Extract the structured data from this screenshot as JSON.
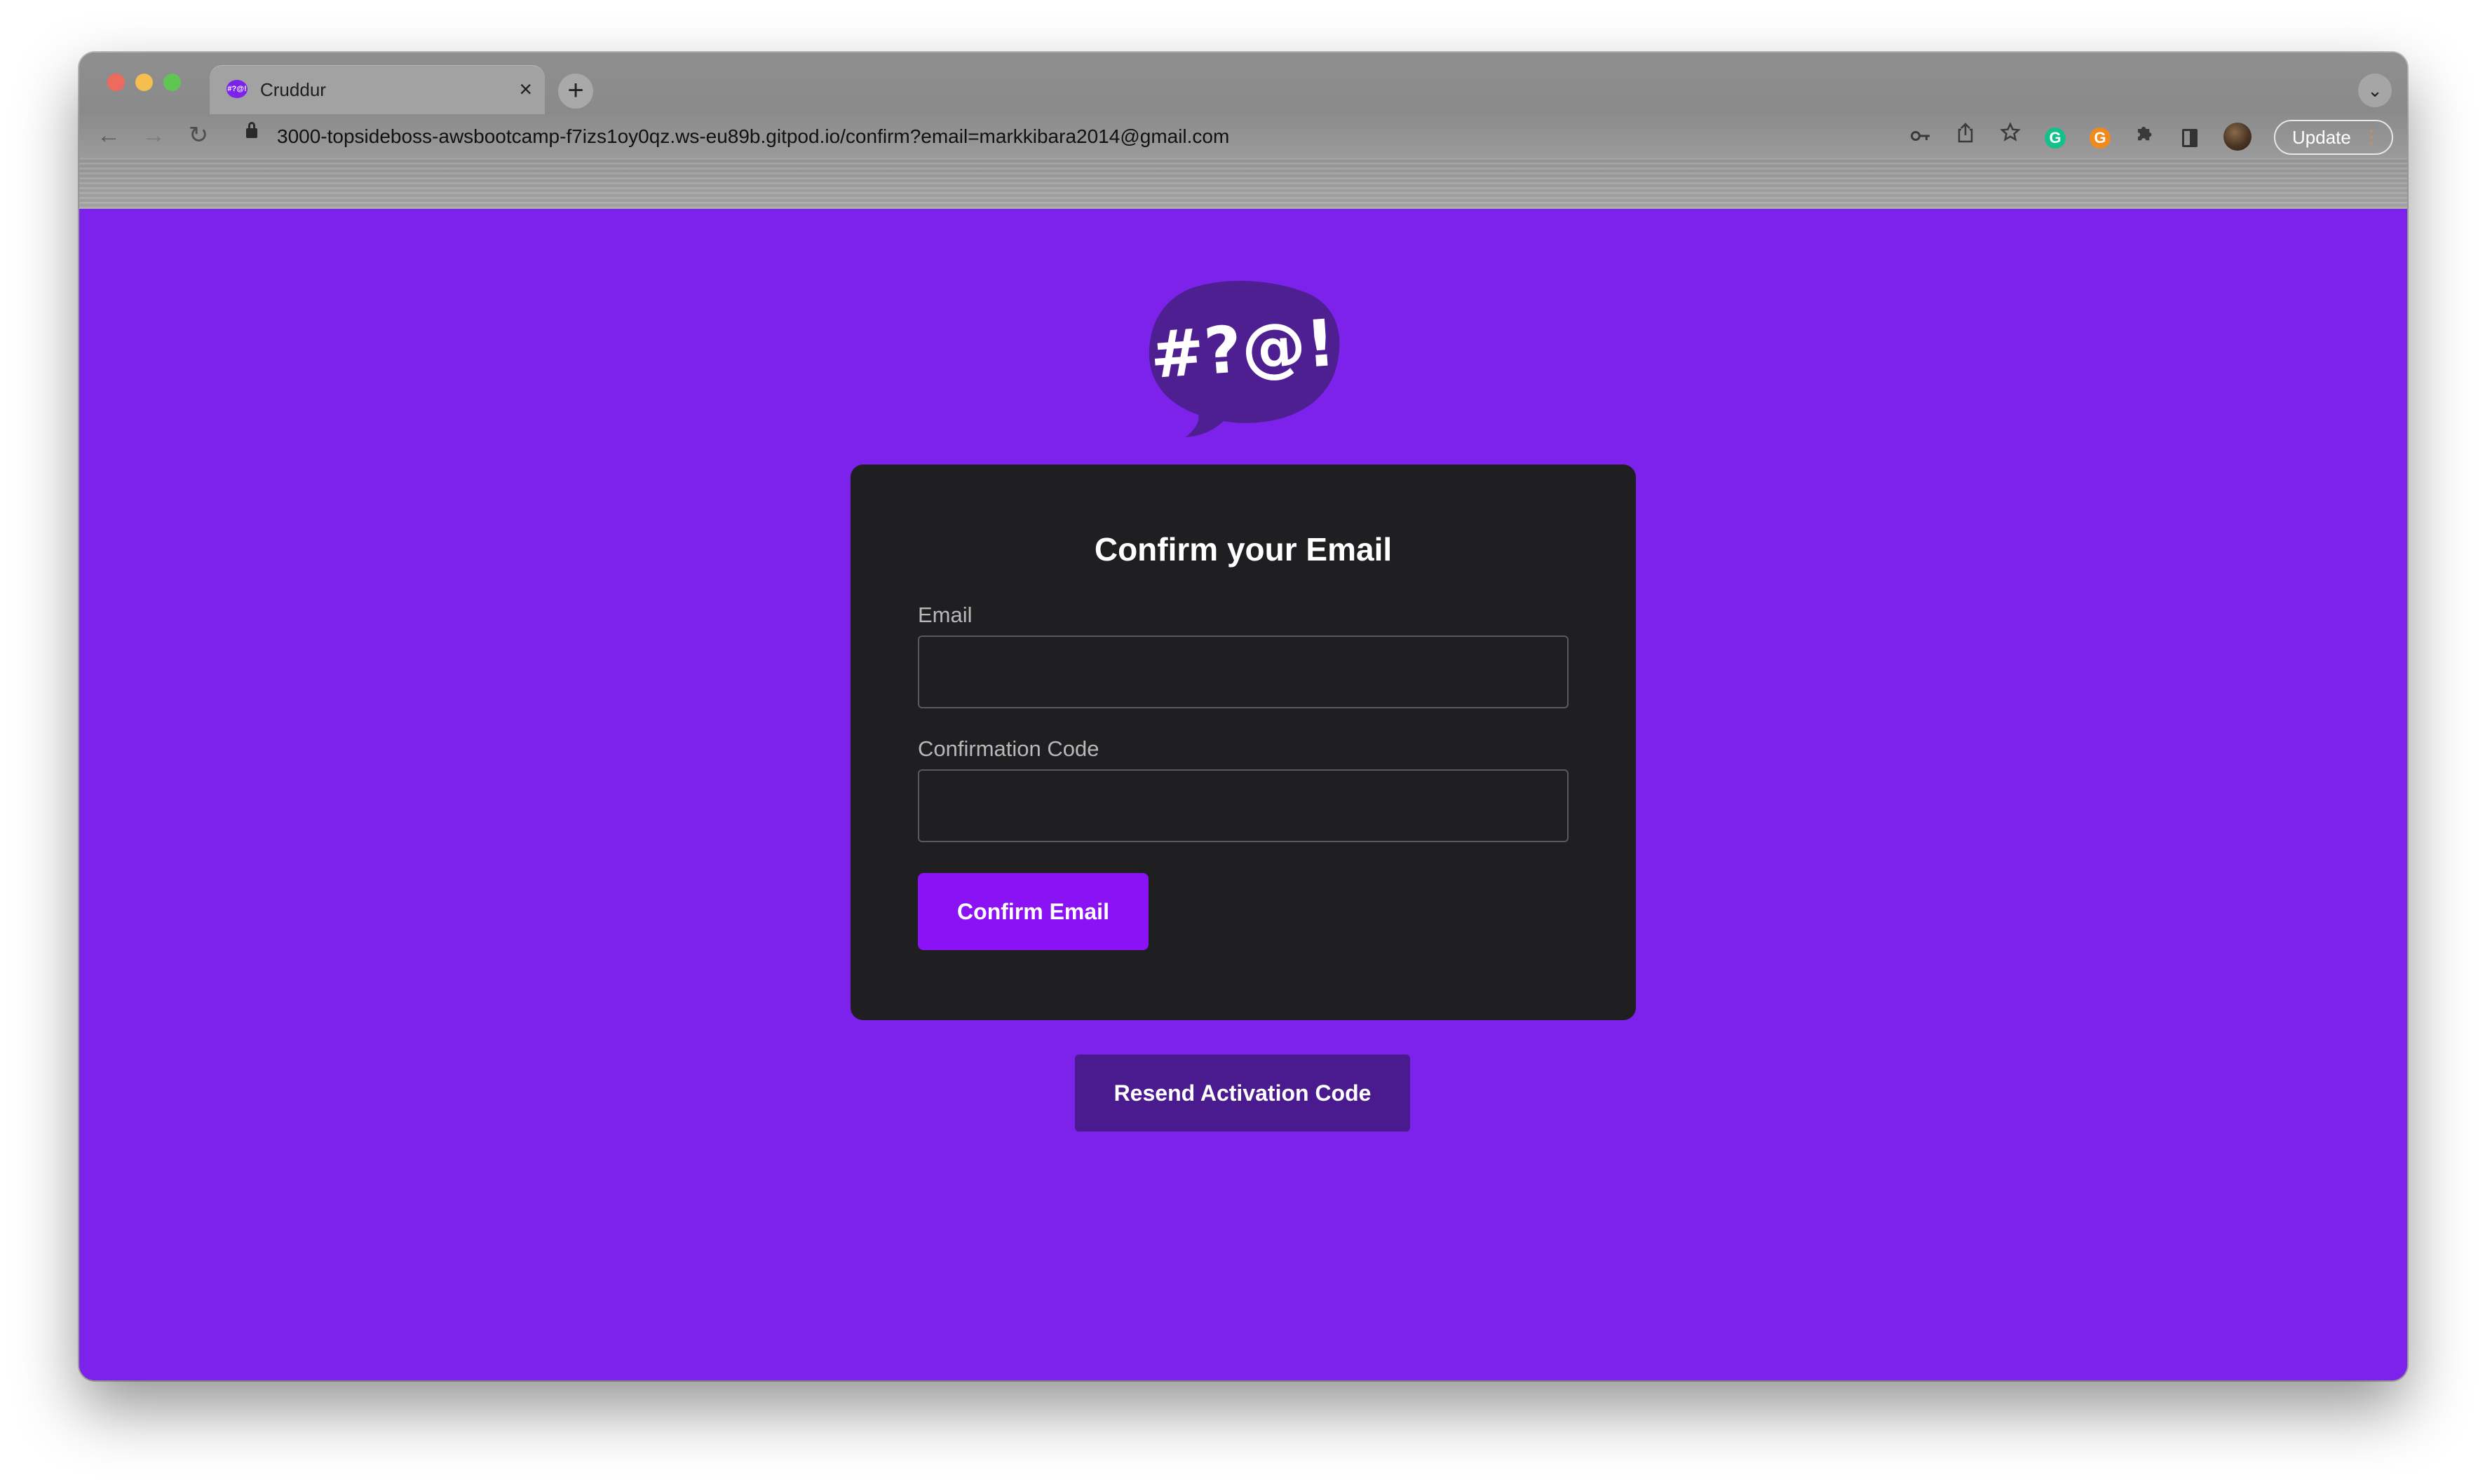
{
  "browser": {
    "tab_title": "Cruddur",
    "tab_favicon_text": "#?@!",
    "tab_close": "×",
    "new_tab": "+",
    "tab_menu": "⌄",
    "url": "3000-topsideboss-awsbootcamp-f7izs1oy0qz.ws-eu89b.gitpod.io/confirm?email=markkibara2014@gmail.com",
    "update_label": "Update",
    "update_dots": "⋮",
    "nav": {
      "back": "←",
      "forward": "→",
      "reload": "↻"
    },
    "toolbar_icons": [
      "key-icon",
      "share-icon",
      "star-icon",
      "grammarly-extension-icon",
      "orange-extension-icon",
      "puzzle-extensions-icon",
      "side-panel-icon",
      "profile-avatar"
    ]
  },
  "page": {
    "logo_text": "#?@!",
    "logo_color": "#4e1f91",
    "title": "Confirm your Email",
    "email_label": "Email",
    "email_value": "",
    "code_label": "Confirmation Code",
    "code_value": "",
    "confirm_button": "Confirm Email",
    "resend_button": "Resend Activation Code"
  },
  "colors": {
    "background": "#7c22ea",
    "card": "#1f1f21",
    "primary_button": "#8a12f5",
    "secondary_button": "#4a1a8f"
  }
}
